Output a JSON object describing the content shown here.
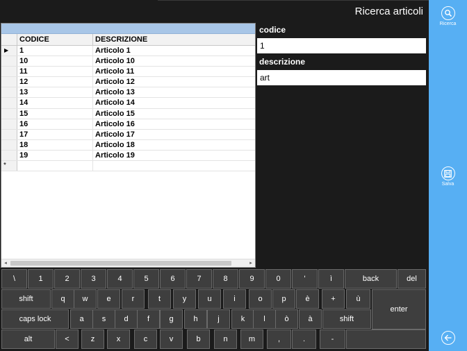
{
  "header": {
    "title": "Ricerca articoli"
  },
  "sidebar": {
    "search": {
      "label": "Ricerca",
      "icon": "search-icon"
    },
    "save": {
      "label": "Salva",
      "icon": "save-icon"
    },
    "back": {
      "icon": "back-arrow-icon"
    }
  },
  "grid": {
    "columns": [
      "CODICE",
      "DESCRIZIONE"
    ],
    "current_row_marker": "▶",
    "new_row_marker": "*",
    "rows": [
      {
        "codice": "1",
        "descrizione": "Articolo 1"
      },
      {
        "codice": "10",
        "descrizione": "Articolo 10"
      },
      {
        "codice": "11",
        "descrizione": "Articolo 11"
      },
      {
        "codice": "12",
        "descrizione": "Articolo 12"
      },
      {
        "codice": "13",
        "descrizione": "Articolo 13"
      },
      {
        "codice": "14",
        "descrizione": "Articolo 14"
      },
      {
        "codice": "15",
        "descrizione": "Articolo 15"
      },
      {
        "codice": "16",
        "descrizione": "Articolo 16"
      },
      {
        "codice": "17",
        "descrizione": "Articolo 17"
      },
      {
        "codice": "18",
        "descrizione": "Articolo 18"
      },
      {
        "codice": "19",
        "descrizione": "Articolo 19"
      }
    ]
  },
  "filters": {
    "codice": {
      "label": "codice",
      "value": "1"
    },
    "descrizione": {
      "label": "descrizione",
      "value": "art"
    }
  },
  "keyboard": {
    "rows": [
      [
        "\\",
        "1",
        "2",
        "3",
        "4",
        "5",
        "6",
        "7",
        "8",
        "9",
        "0",
        "'",
        "ì",
        "back",
        "del"
      ],
      [
        "shift",
        "q",
        "w",
        "e",
        "r",
        "t",
        "y",
        "u",
        "i",
        "o",
        "p",
        "è",
        "+",
        "ù",
        "enter"
      ],
      [
        "caps lock",
        "a",
        "s",
        "d",
        "f",
        "g",
        "h",
        "j",
        "k",
        "l",
        "ò",
        "à",
        "shift"
      ],
      [
        "alt",
        "<",
        "z",
        "x",
        "c",
        "v",
        "b",
        "n",
        "m",
        ",",
        ".",
        "-",
        " "
      ]
    ]
  },
  "colors": {
    "accent": "#57aff3",
    "background": "#1b1b1b",
    "grid_caption": "#a8c6e7",
    "key": "#3e3e3e"
  }
}
